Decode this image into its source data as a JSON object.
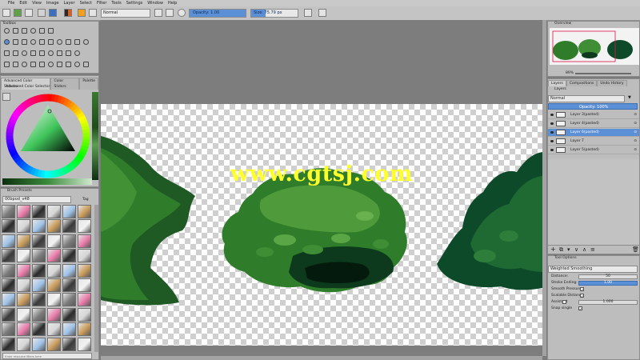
{
  "menu": [
    "File",
    "Edit",
    "View",
    "Image",
    "Layer",
    "Select",
    "Filter",
    "Tools",
    "Settings",
    "Window",
    "Help"
  ],
  "toolbar": {
    "blend_mode": "Normal",
    "opacity_label": "Opacity:  1.00",
    "opacity_value": 1.0,
    "size_label": "Size:  75.79 px"
  },
  "toolbox": {
    "title": "Toolbox"
  },
  "color_panel": {
    "tabs": [
      "Advanced Color Selector",
      "Color Sliders",
      "Palette"
    ],
    "subtitle": "Advanced Color Selector"
  },
  "brush_presets": {
    "title": "Brush Presets",
    "filter": "00bpod_v48",
    "tag_label": "Tag",
    "search_placeholder": "Enter resource filters here"
  },
  "overview": {
    "title": "Overview",
    "zoom": "89%"
  },
  "layers_panel": {
    "tabs": [
      "Layers",
      "Compositions",
      "Undo History"
    ],
    "title": "Layers",
    "blend_mode": "Normal",
    "opacity_label": "Opacity:  100%",
    "layers": [
      {
        "name": "Layer 3(pasted)",
        "selected": false
      },
      {
        "name": "Layer 4(pasted)",
        "selected": false
      },
      {
        "name": "Layer 6(pasted)",
        "selected": true
      },
      {
        "name": "Layer 7",
        "selected": false
      },
      {
        "name": "Layer 5(pasted)",
        "selected": false
      }
    ]
  },
  "tool_options": {
    "title": "Tool Options",
    "smoothing_mode": "Weighted Smoothing",
    "distance_label": "Distance:",
    "distance_value": "50",
    "stroke_ending_label": "Stroke Ending:",
    "stroke_ending_value": "1.00",
    "smooth_pressure_label": "Smooth Pressure",
    "scalable_distance_label": "Scalable Distance",
    "assistant_label": "Assistant",
    "assistant_value": "1.000",
    "snap_single_label": "Snap single"
  },
  "watermark": "www.cgtsj.com",
  "colors": {
    "accent": "#5b8fd6",
    "panel": "#bdbdbd",
    "bush_dark": "#0d3a1c",
    "bush_mid": "#2f7d2a",
    "bush_light": "#4f9a3a",
    "watermark": "#ffff2a"
  }
}
